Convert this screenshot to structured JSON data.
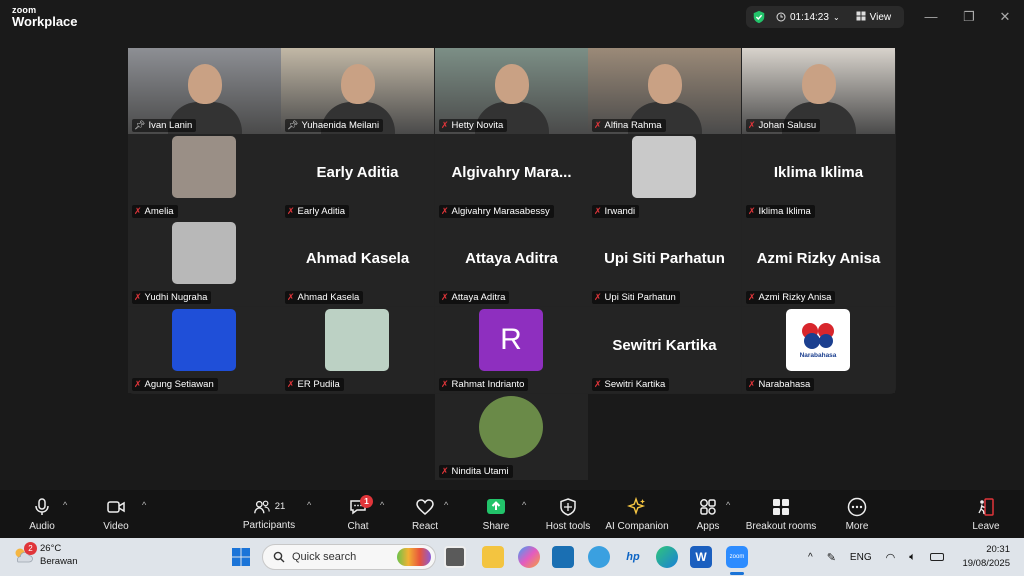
{
  "app": {
    "logo_top": "zoom",
    "logo_bottom": "Workplace"
  },
  "meeting": {
    "timer": "01:14:23",
    "view_label": "View",
    "secure_color": "#22c36a"
  },
  "participants": [
    {
      "name": "Ivan Lanin",
      "type": "video",
      "pinned": true
    },
    {
      "name": "Yuhaenida Meilani",
      "type": "video",
      "pinned": true,
      "active": true
    },
    {
      "name": "Hetty Novita",
      "type": "video"
    },
    {
      "name": "Alfina Rahma",
      "type": "video"
    },
    {
      "name": "Johan Salusu",
      "type": "video"
    },
    {
      "name": "Amelia",
      "type": "photo"
    },
    {
      "name": "Early Aditia",
      "type": "text",
      "display": "Early Aditia"
    },
    {
      "name": "Algivahry Marasabessy",
      "type": "text",
      "display": "Algivahry  Mara..."
    },
    {
      "name": "Irwandi",
      "type": "photo"
    },
    {
      "name": "Iklima Iklima",
      "type": "text",
      "display": "Iklima Iklima"
    },
    {
      "name": "Yudhi Nugraha",
      "type": "photo"
    },
    {
      "name": "Ahmad Kasela",
      "type": "text",
      "display": "Ahmad Kasela"
    },
    {
      "name": "Attaya Aditra",
      "type": "text",
      "display": "Attaya Aditra"
    },
    {
      "name": "Upi Siti Parhatun",
      "type": "text",
      "display": "Upi Siti Parhatun"
    },
    {
      "name": "Azmi Rizky Anisa",
      "type": "text",
      "display": "Azmi Rizky Anisa"
    },
    {
      "name": "Agung Setiawan",
      "type": "photo"
    },
    {
      "name": "ER Pudila",
      "type": "photo"
    },
    {
      "name": "Rahmat Indrianto",
      "type": "avatar",
      "initial": "R"
    },
    {
      "name": "Sewitri Kartika",
      "type": "text",
      "display": "Sewitri Kartika"
    },
    {
      "name": "Narabahasa",
      "type": "logo",
      "logo_text": "Narabahasa"
    },
    {
      "name": "Nindita Utami",
      "type": "photo"
    }
  ],
  "toolbar": {
    "audio": "Audio",
    "video": "Video",
    "participants": "Participants",
    "participants_count": "21",
    "chat": "Chat",
    "chat_badge": "1",
    "react": "React",
    "share": "Share",
    "host_tools": "Host tools",
    "ai_companion": "AI Companion",
    "apps": "Apps",
    "breakout_rooms": "Breakout rooms",
    "more": "More",
    "leave": "Leave"
  },
  "taskbar": {
    "weather_temp": "26°C",
    "weather_desc": "Berawan",
    "weather_badge": "2",
    "search_placeholder": "Quick search",
    "language": "ENG",
    "time": "20:31",
    "date": "19/08/2025"
  }
}
